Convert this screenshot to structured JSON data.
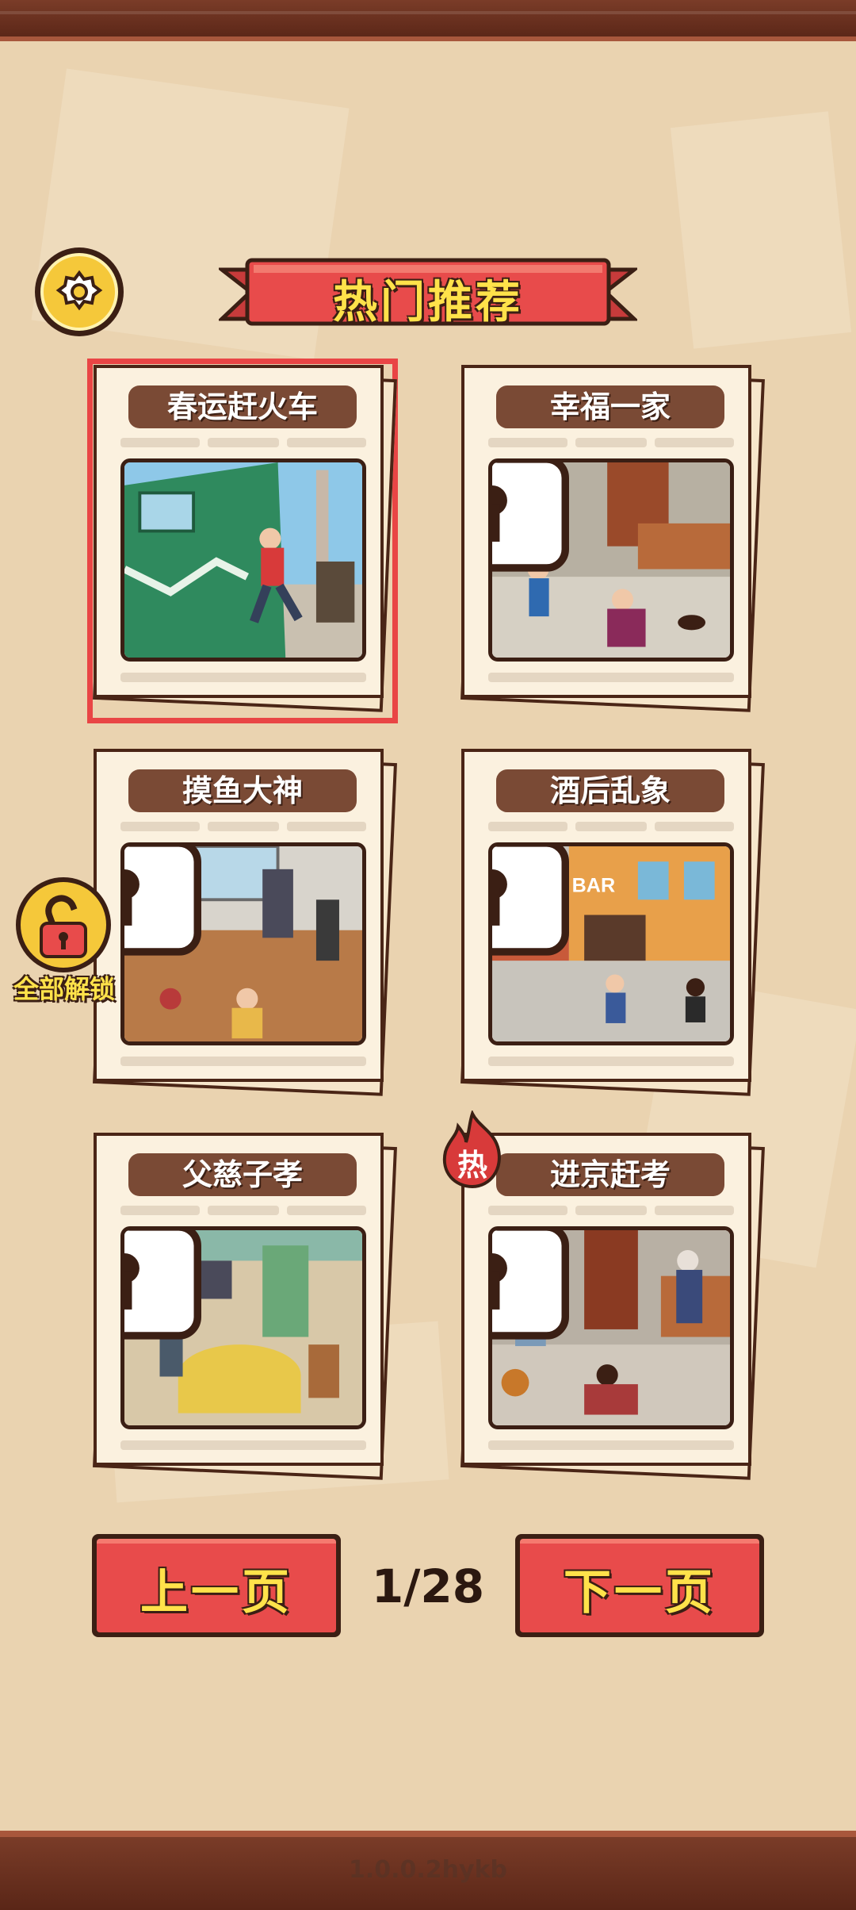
{
  "header": {
    "title": "热门推荐"
  },
  "cards": [
    {
      "label": "春运赶火车",
      "locked": false,
      "selected": true
    },
    {
      "label": "幸福一家",
      "locked": true
    },
    {
      "label": "摸鱼大神",
      "locked": true
    },
    {
      "label": "酒后乱象",
      "locked": true
    },
    {
      "label": "父慈子孝",
      "locked": true
    },
    {
      "label": "进京赶考",
      "locked": true,
      "badge": "热"
    }
  ],
  "unlock_all": {
    "label": "全部解锁"
  },
  "pagination": {
    "prev_label": "上一页",
    "next_label": "下一页",
    "indicator": "1/28"
  },
  "scene_texts": {
    "bar_sign": "BAR"
  },
  "footer": {
    "version": "1.0.0.2hykb"
  },
  "colors": {
    "background": "#ead3b0",
    "accent_red": "#e84b4b",
    "accent_yellow": "#ffe24a",
    "dark_brown": "#3b1f14",
    "selection": "#e94545"
  }
}
